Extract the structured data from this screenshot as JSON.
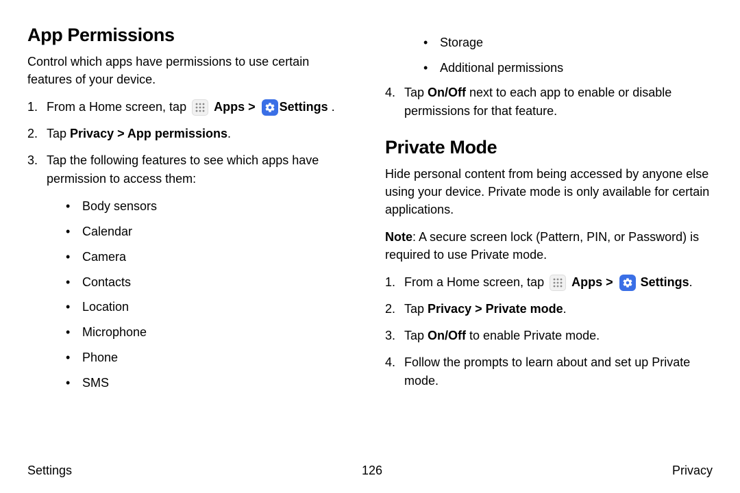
{
  "section1": {
    "title": "App Permissions",
    "intro": "Control which apps have permissions to use certain features of your device.",
    "step1_prefix": "From a Home screen, tap ",
    "step1_apps": "Apps",
    "step1_sep": " > ",
    "step1_settings": "Settings",
    "step1_suffix": " .",
    "step2_prefix": "Tap ",
    "step2_bold": "Privacy > App permissions",
    "step2_suffix": ".",
    "step3": "Tap the following features to see which apps have permission to access them:",
    "features_left": [
      "Body sensors",
      "Calendar",
      "Camera",
      "Contacts",
      "Location",
      "Microphone",
      "Phone",
      "SMS"
    ],
    "features_right": [
      "Storage",
      "Additional permissions"
    ],
    "step4_prefix": "Tap ",
    "step4_bold": "On/Off",
    "step4_suffix": " next to each app to enable or disable permissions for that feature."
  },
  "section2": {
    "title": "Private Mode",
    "intro": "Hide personal content from being accessed by anyone else using your device. Private mode is only available for certain applications.",
    "note_bold": "Note",
    "note_rest": ": A secure screen lock (Pattern, PIN, or Password) is required to use Private mode.",
    "step1_prefix": "From a Home screen, tap ",
    "step1_apps": "Apps",
    "step1_sep": " > ",
    "step1_settings": "Settings",
    "step1_suffix": ".",
    "step2_prefix": "Tap ",
    "step2_bold": "Privacy > Private mode",
    "step2_suffix": ".",
    "step3_prefix": "Tap ",
    "step3_bold": "On/Off",
    "step3_suffix": " to enable Private mode.",
    "step4": "Follow the prompts to learn about and set up Private mode."
  },
  "footer": {
    "left": "Settings",
    "center": "126",
    "right": "Privacy"
  }
}
